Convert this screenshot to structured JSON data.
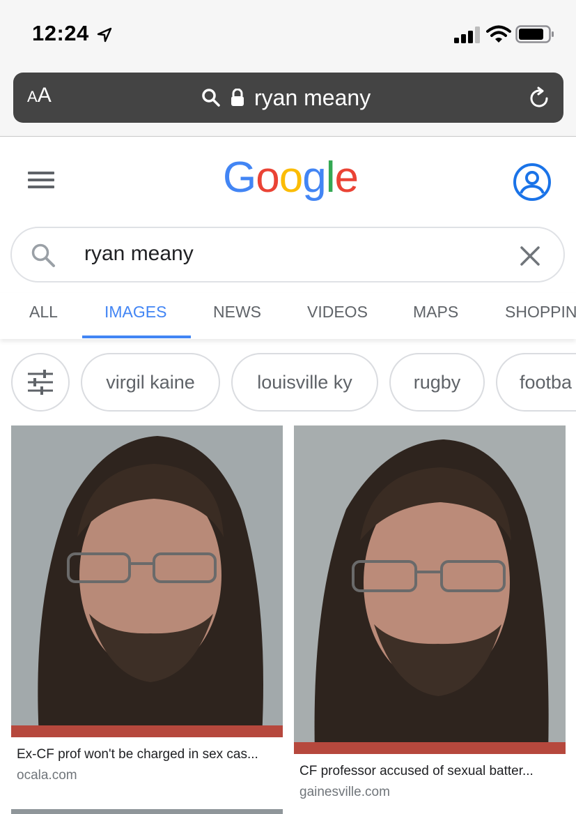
{
  "status_bar": {
    "time": "12:24"
  },
  "browser": {
    "text_size_small": "A",
    "text_size_large": "A",
    "url_text": "ryan meany"
  },
  "google": {
    "logo": [
      "G",
      "o",
      "o",
      "g",
      "l",
      "e"
    ],
    "logo_colors": [
      "#4285f4",
      "#ea4335",
      "#fbbc05",
      "#4285f4",
      "#34a853",
      "#ea4335"
    ]
  },
  "search": {
    "query": "ryan meany"
  },
  "tabs": [
    {
      "label": "ALL",
      "active": false
    },
    {
      "label": "IMAGES",
      "active": true
    },
    {
      "label": "NEWS",
      "active": false
    },
    {
      "label": "VIDEOS",
      "active": false
    },
    {
      "label": "MAPS",
      "active": false
    },
    {
      "label": "SHOPPIN",
      "active": false
    }
  ],
  "chips": [
    "virgil kaine",
    "louisville ky",
    "rugby",
    "footba"
  ],
  "results": [
    {
      "caption": "Ex-CF prof won't be charged in sex cas...",
      "source": "ocala.com"
    },
    {
      "caption": "CF professor accused of sexual batter...",
      "source": "gainesville.com"
    }
  ],
  "colors": {
    "accent": "#4285f4",
    "url_bar": "#444444",
    "tab_text": "#5f6368"
  }
}
